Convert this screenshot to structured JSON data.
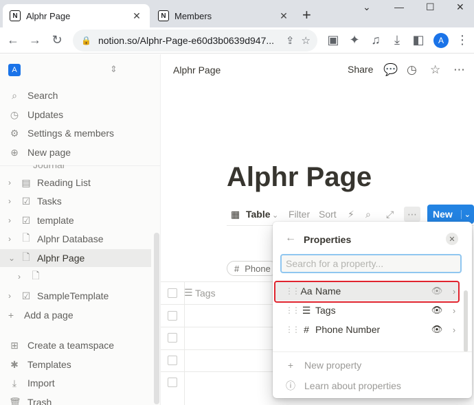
{
  "browser": {
    "tabs": [
      {
        "title": "Alphr Page",
        "favicon": "N",
        "active": true
      },
      {
        "title": "Members",
        "favicon": "N",
        "active": false
      }
    ],
    "url": "notion.so/Alphr-Page-e60d3b0639d947...",
    "profile_initial": "A"
  },
  "sidebar": {
    "workspace_initial": "A",
    "top_items": [
      {
        "label": "Search",
        "icon": "search-icon"
      },
      {
        "label": "Updates",
        "icon": "clock-icon"
      },
      {
        "label": "Settings & members",
        "icon": "gear-icon"
      },
      {
        "label": "New page",
        "icon": "plus-circle-icon"
      }
    ],
    "partial_item": "Journal",
    "pages": [
      {
        "label": "Reading List",
        "icon": "book-icon"
      },
      {
        "label": "Tasks",
        "icon": "checkbox-icon"
      },
      {
        "label": "template",
        "icon": "checkbox-icon"
      },
      {
        "label": "Alphr Database",
        "icon": "page-icon"
      },
      {
        "label": "Alphr Page",
        "icon": "page-icon",
        "selected": true
      },
      {
        "label": "",
        "icon": "page-icon"
      },
      {
        "label": "SampleTemplate",
        "icon": "checkbox-icon"
      }
    ],
    "add_page": "Add a page",
    "bottom_items": [
      {
        "label": "Create a teamspace",
        "icon": "teamspace-icon"
      },
      {
        "label": "Templates",
        "icon": "templates-icon"
      },
      {
        "label": "Import",
        "icon": "import-icon"
      },
      {
        "label": "Trash",
        "icon": "trash-icon"
      }
    ]
  },
  "topbar": {
    "breadcrumb": "Alphr Page",
    "share": "Share"
  },
  "page": {
    "title": "Alphr Page"
  },
  "viewbar": {
    "view": "Table",
    "filter": "Filter",
    "sort": "Sort",
    "new": "New"
  },
  "filter_chip": "Phone",
  "table": {
    "column": "Tags"
  },
  "popover": {
    "title": "Properties",
    "search_placeholder": "Search for a property...",
    "properties": [
      {
        "icon": "Aa",
        "name": "Name",
        "visible": true,
        "highlighted": true
      },
      {
        "icon": "☰",
        "name": "Tags",
        "visible": true
      },
      {
        "icon": "#",
        "name": "Phone Number",
        "visible": true
      }
    ],
    "footer": [
      {
        "label": "New property",
        "icon": "plus-icon"
      },
      {
        "label": "Learn about properties",
        "icon": "help-icon"
      }
    ]
  },
  "colors": {
    "accent": "#2383e2",
    "highlight_border": "#e0232d"
  }
}
